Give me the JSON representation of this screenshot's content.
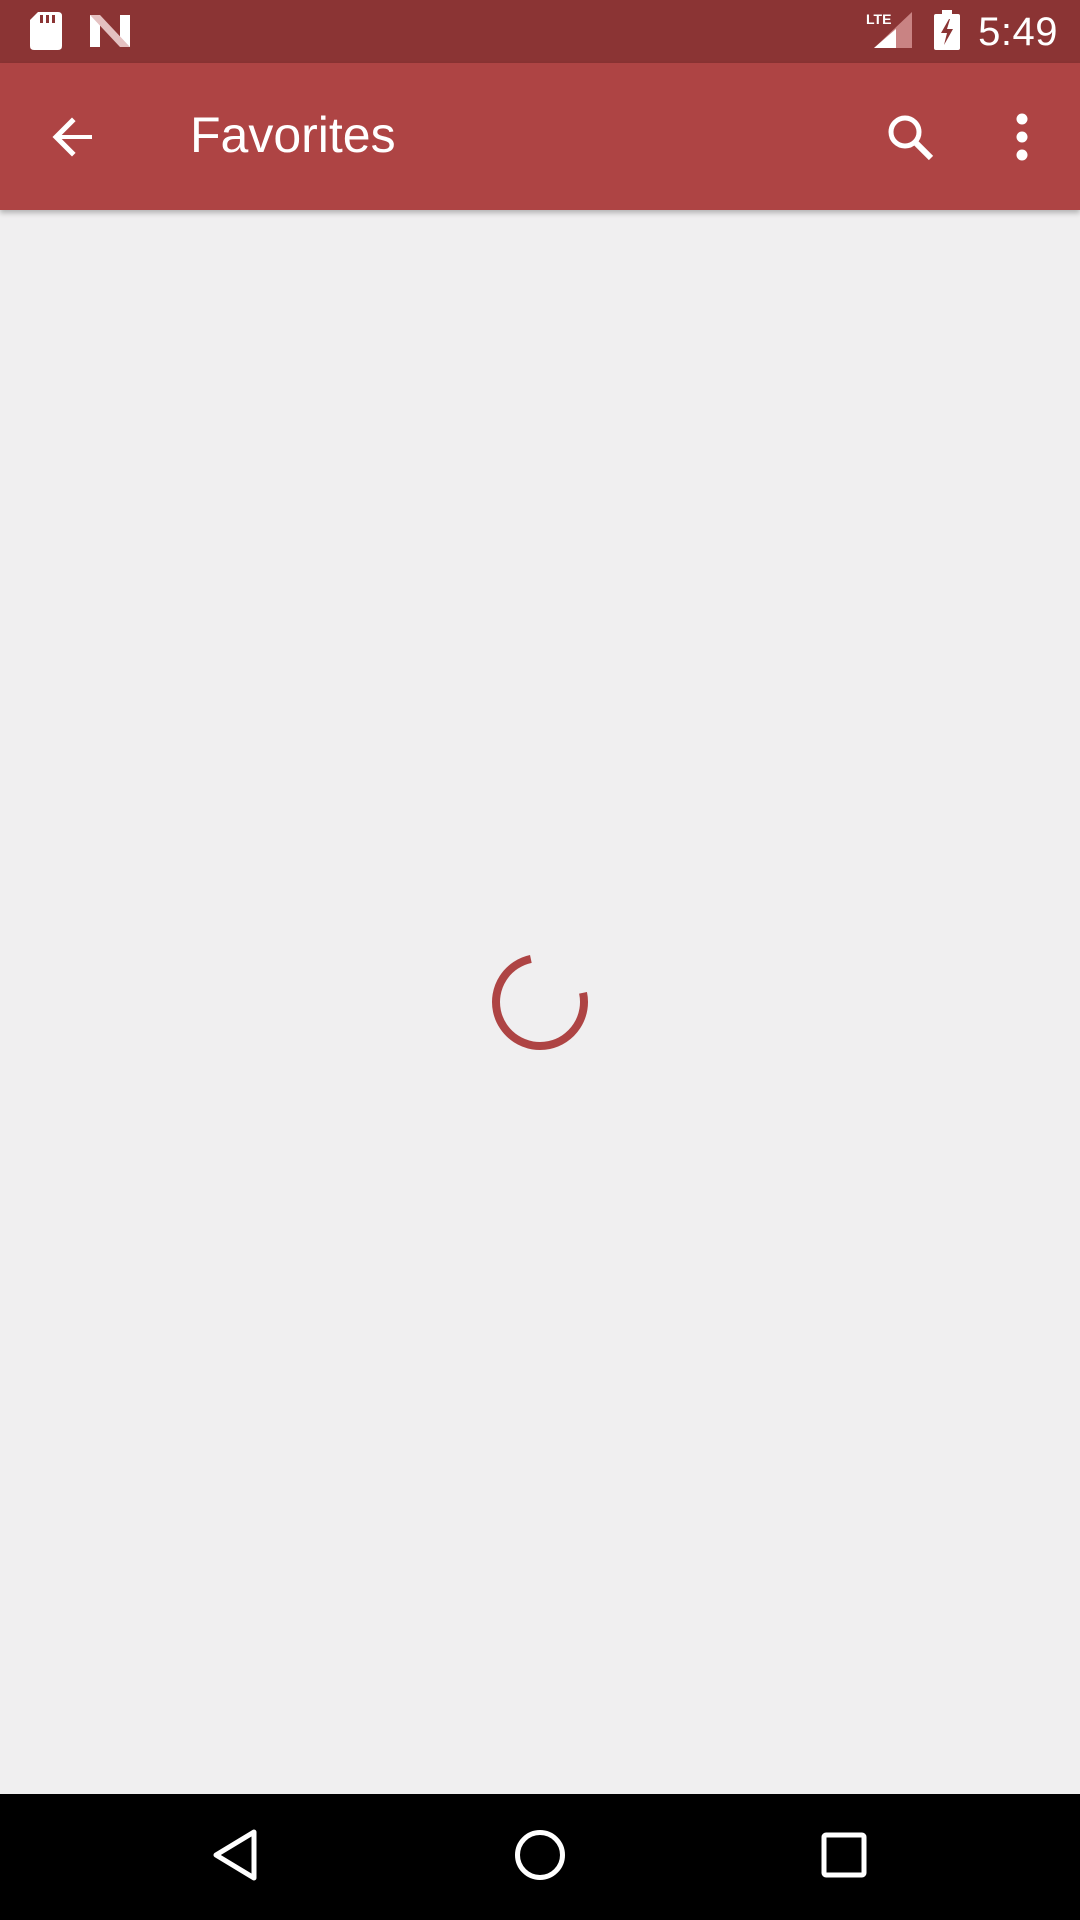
{
  "status_bar": {
    "time": "5:49",
    "network": "LTE",
    "icons": [
      "sd-card-icon",
      "n-logo-icon",
      "lte-signal-icon",
      "battery-charging-icon"
    ]
  },
  "app_bar": {
    "title": "Favorites",
    "back_icon": "arrow-back-icon",
    "search_icon": "search-icon",
    "more_icon": "more-vert-icon"
  },
  "content": {
    "state": "loading",
    "spinner_icon": "progress-spinner-icon"
  },
  "nav_bar": {
    "icons": [
      "back-triangle-icon",
      "home-circle-icon",
      "recents-square-icon"
    ]
  },
  "colors": {
    "status_bar": "#8b3434",
    "app_bar": "#ae4444",
    "background": "#f0eff0",
    "accent": "#ae4444",
    "nav_bar": "#000000"
  }
}
